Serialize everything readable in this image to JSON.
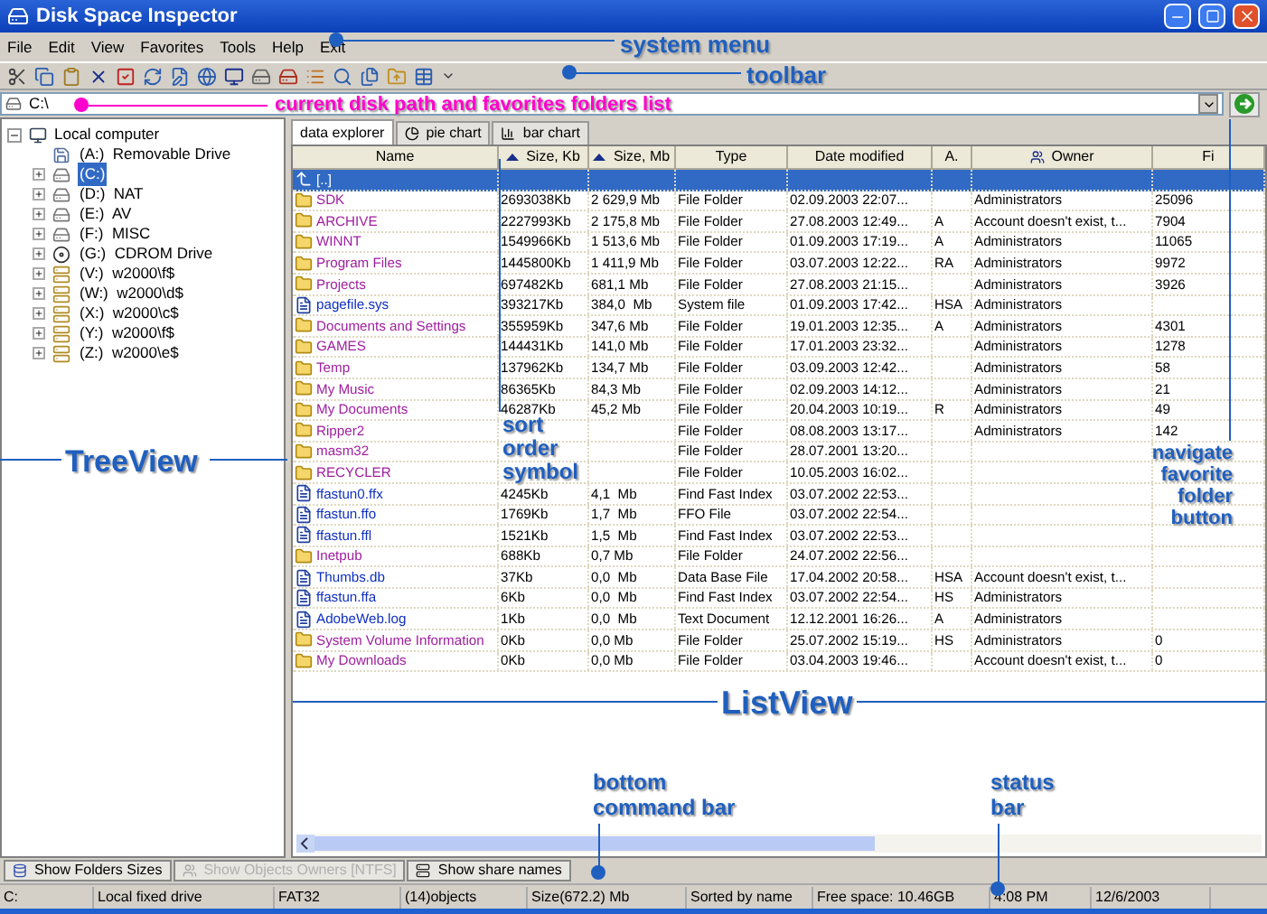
{
  "window": {
    "title": "Disk Space Inspector"
  },
  "menu": [
    "File",
    "Edit",
    "View",
    "Favorites",
    "Tools",
    "Help",
    "Exit"
  ],
  "path": {
    "value": "C:\\"
  },
  "tree": {
    "label": "Local computer",
    "expanded": true,
    "children": [
      {
        "label": "(A:)  Removable Drive",
        "kind": "floppy",
        "selected": false
      },
      {
        "label": "(C:)",
        "kind": "disk",
        "selected": true
      },
      {
        "label": "(D:)  NAT",
        "kind": "disk",
        "selected": false
      },
      {
        "label": "(E:)  AV",
        "kind": "disk",
        "selected": false
      },
      {
        "label": "(F:)  MISC",
        "kind": "disk",
        "selected": false
      },
      {
        "label": "(G:)  CDROM Drive",
        "kind": "cdrom",
        "selected": false
      },
      {
        "label": "(V:)  w2000\\f$",
        "kind": "network",
        "selected": false
      },
      {
        "label": "(W:)  w2000\\d$",
        "kind": "network",
        "selected": false
      },
      {
        "label": "(X:)  w2000\\c$",
        "kind": "network",
        "selected": false
      },
      {
        "label": "(Y:)  w2000\\f$",
        "kind": "network",
        "selected": false
      },
      {
        "label": "(Z:)  w2000\\e$",
        "kind": "network",
        "selected": false
      }
    ]
  },
  "tabs": [
    {
      "label": "data explorer",
      "selected": true
    },
    {
      "label": "pie chart",
      "selected": false
    },
    {
      "label": "bar chart",
      "selected": false
    }
  ],
  "columns": [
    {
      "label": "Name",
      "sorted": false
    },
    {
      "label": "Size, Kb",
      "sorted": true
    },
    {
      "label": "Size, Mb",
      "sorted": true
    },
    {
      "label": "Type",
      "sorted": false
    },
    {
      "label": "Date modified",
      "sorted": false
    },
    {
      "label": "A.",
      "sorted": false
    },
    {
      "label": "Owner",
      "sorted": false
    },
    {
      "label": "Fi",
      "sorted": false
    }
  ],
  "rows": [
    {
      "kind": "up",
      "name": "[..]",
      "selected": true
    },
    {
      "kind": "folder",
      "name": "SDK",
      "size_kb": "2693038Kb",
      "size_mb": "2 629,9 Mb",
      "type": "File Folder",
      "date": "02.09.2003 22:07...",
      "owner": "Administrators",
      "files": "25096",
      "selected": false
    },
    {
      "kind": "folder",
      "name": "ARCHIVE",
      "size_kb": "2227993Kb",
      "size_mb": "2 175,8 Mb",
      "type": "File Folder",
      "date": "27.08.2003 12:49...",
      "attr": "A",
      "owner": "Account doesn't exist, t...",
      "files": "7904",
      "selected": false
    },
    {
      "kind": "folder",
      "name": "WINNT",
      "size_kb": "1549966Kb",
      "size_mb": "1 513,6 Mb",
      "type": "File Folder",
      "date": "01.09.2003 17:19...",
      "attr": "A",
      "owner": "Administrators",
      "files": "11065",
      "selected": false
    },
    {
      "kind": "folder",
      "name": "Program Files",
      "size_kb": "1445800Kb",
      "size_mb": "1 411,9 Mb",
      "type": "File Folder",
      "date": "03.07.2003 12:22...",
      "attr": "RA",
      "owner": "Administrators",
      "files": "9972",
      "selected": false
    },
    {
      "kind": "folder",
      "name": "Projects",
      "size_kb": "697482Kb",
      "size_mb": "681,1 Mb",
      "type": "File Folder",
      "date": "27.08.2003 21:15...",
      "owner": "Administrators",
      "files": "3926",
      "selected": false
    },
    {
      "kind": "file",
      "name": "pagefile.sys",
      "size_kb": "393217Kb",
      "size_mb": "384,0  Mb",
      "type": "System file",
      "date": "01.09.2003 17:42...",
      "attr": "HSA",
      "owner": "Administrators",
      "selected": false
    },
    {
      "kind": "folder",
      "name": "Documents and Settings",
      "size_kb": "355959Kb",
      "size_mb": "347,6 Mb",
      "type": "File Folder",
      "date": "19.01.2003 12:35...",
      "attr": "A",
      "owner": "Administrators",
      "files": "4301",
      "selected": false
    },
    {
      "kind": "folder",
      "name": "GAMES",
      "size_kb": "144431Kb",
      "size_mb": "141,0 Mb",
      "type": "File Folder",
      "date": "17.01.2003 23:32...",
      "owner": "Administrators",
      "files": "1278",
      "selected": false
    },
    {
      "kind": "folder",
      "name": "Temp",
      "size_kb": "137962Kb",
      "size_mb": "134,7 Mb",
      "type": "File Folder",
      "date": "03.09.2003 12:42...",
      "owner": "Administrators",
      "files": "58",
      "selected": false
    },
    {
      "kind": "folder",
      "name": "My Music",
      "size_kb": "86365Kb",
      "size_mb": "84,3 Mb",
      "type": "File Folder",
      "date": "02.09.2003 14:12...",
      "owner": "Administrators",
      "files": "21",
      "selected": false
    },
    {
      "kind": "folder",
      "name": "My Documents",
      "size_kb": "46287Kb",
      "size_mb": "45,2 Mb",
      "type": "File Folder",
      "date": "20.04.2003 10:19...",
      "attr": "R",
      "owner": "Administrators",
      "files": "49",
      "selected": false
    },
    {
      "kind": "folder",
      "name": "Ripper2",
      "type": "File Folder",
      "date": "08.08.2003 13:17...",
      "owner": "Administrators",
      "files": "142",
      "selected": false
    },
    {
      "kind": "folder",
      "name": "masm32",
      "type": "File Folder",
      "date": "28.07.2001 13:20...",
      "selected": false
    },
    {
      "kind": "folder",
      "name": "RECYCLER",
      "type": "File Folder",
      "date": "10.05.2003 16:02...",
      "selected": false
    },
    {
      "kind": "file",
      "name": "ffastun0.ffx",
      "size_kb": "4245Kb",
      "size_mb": "4,1  Mb",
      "type": "Find Fast Index",
      "date": "03.07.2002 22:53...",
      "selected": false
    },
    {
      "kind": "file",
      "name": "ffastun.ffo",
      "size_kb": "1769Kb",
      "size_mb": "1,7  Mb",
      "type": "FFO File",
      "date": "03.07.2002 22:54...",
      "selected": false
    },
    {
      "kind": "file",
      "name": "ffastun.ffl",
      "size_kb": "1521Kb",
      "size_mb": "1,5  Mb",
      "type": "Find Fast Index",
      "date": "03.07.2002 22:53...",
      "selected": false
    },
    {
      "kind": "folder",
      "name": "Inetpub",
      "size_kb": "688Kb",
      "size_mb": "0,7 Mb",
      "type": "File Folder",
      "date": "24.07.2002 22:56...",
      "selected": false
    },
    {
      "kind": "file",
      "name": "Thumbs.db",
      "size_kb": "37Kb",
      "size_mb": "0,0  Mb",
      "type": "Data Base File",
      "date": "17.04.2002 20:58...",
      "attr": "HSA",
      "owner": "Account doesn't exist, t...",
      "selected": false
    },
    {
      "kind": "file",
      "name": "ffastun.ffa",
      "size_kb": "6Kb",
      "size_mb": "0,0  Mb",
      "type": "Find Fast Index",
      "date": "03.07.2002 22:54...",
      "attr": "HS",
      "owner": "Administrators",
      "selected": false
    },
    {
      "kind": "file",
      "name": "AdobeWeb.log",
      "size_kb": "1Kb",
      "size_mb": "0,0  Mb",
      "type": "Text Document",
      "date": "12.12.2001 16:26...",
      "attr": "A",
      "owner": "Administrators",
      "selected": false
    },
    {
      "kind": "folder",
      "name": "System Volume Information",
      "size_kb": "0Kb",
      "size_mb": "0,0 Mb",
      "type": "File Folder",
      "date": "25.07.2002 15:19...",
      "attr": "HS",
      "owner": "Administrators",
      "files": "0",
      "selected": false
    },
    {
      "kind": "folder",
      "name": "My Downloads",
      "size_kb": "0Kb",
      "size_mb": "0,0 Mb",
      "type": "File Folder",
      "date": "03.04.2003 19:46...",
      "owner": "Account doesn't exist, t...",
      "files": "0",
      "selected": false
    }
  ],
  "bottom_bar": [
    {
      "label": "Show Folders Sizes",
      "disabled": false
    },
    {
      "label": "Show Objects Owners [NTFS]",
      "disabled": true
    },
    {
      "label": "Show share names",
      "disabled": false
    }
  ],
  "status_bar": [
    "C:",
    "Local fixed drive",
    "FAT32",
    "(14)objects",
    "Size(672.2) Mb",
    "Sorted by name",
    "Free space: 10.46GB",
    "4:08 PM",
    "12/6/2003"
  ],
  "annotations": [
    {
      "text": "system menu",
      "color": "#1f5fbf"
    },
    {
      "text": "toolbar",
      "color": "#1f5fbf"
    },
    {
      "text": "current disk path and favorites folders list",
      "color": "#ff00cc"
    },
    {
      "text": "TreeView",
      "color": "#1f5fbf"
    },
    {
      "text": "sort order symbol",
      "color": "#1f5fbf"
    },
    {
      "text": "navigate favorite folder button",
      "color": "#1f5fbf"
    },
    {
      "text": "ListView",
      "color": "#1f5fbf"
    },
    {
      "text": "bottom command bar",
      "color": "#1f5fbf"
    },
    {
      "text": "status bar",
      "color": "#1f5fbf"
    }
  ]
}
